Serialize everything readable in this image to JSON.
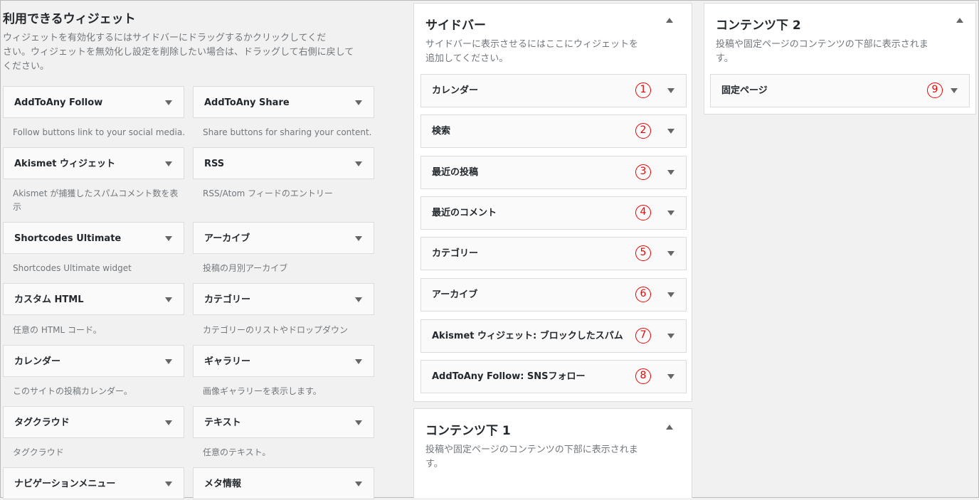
{
  "available": {
    "title": "利用できるウィジェット",
    "desc_line1": "ウィジェットを有効化するにはサイドバーにドラッグするかクリックしてくだ",
    "desc_line2": "さい。ウィジェットを無効化し設定を削除したい場合は、ドラッグして右側に戻して",
    "desc_line3": "ください。",
    "widgets": [
      {
        "name": "AddToAny Follow",
        "desc": "Follow buttons link to your social media."
      },
      {
        "name": "AddToAny Share",
        "desc": "Share buttons for sharing your content."
      },
      {
        "name": "Akismet ウィジェット",
        "desc": "Akismet が捕獲したスパムコメント数を表示"
      },
      {
        "name": "RSS",
        "desc": "RSS/Atom フィードのエントリー"
      },
      {
        "name": "Shortcodes Ultimate",
        "desc": "Shortcodes Ultimate widget"
      },
      {
        "name": "アーカイブ",
        "desc": "投稿の月別アーカイブ"
      },
      {
        "name": "カスタム HTML",
        "desc": "任意の HTML コード。"
      },
      {
        "name": "カテゴリー",
        "desc": "カテゴリーのリストやドロップダウン"
      },
      {
        "name": "カレンダー",
        "desc": "このサイトの投稿カレンダー。"
      },
      {
        "name": "ギャラリー",
        "desc": "画像ギャラリーを表示します。"
      },
      {
        "name": "タグクラウド",
        "desc": "タグクラウド"
      },
      {
        "name": "テキスト",
        "desc": "任意のテキスト。"
      },
      {
        "name": "ナビゲーションメニュー",
        "desc": ""
      },
      {
        "name": "メタ情報",
        "desc": ""
      }
    ]
  },
  "sidebar": {
    "title": "サイドバー",
    "desc_line1": "サイドバーに表示させるにはここにウィジェットを",
    "desc_line2": "追加してください。",
    "widgets": [
      {
        "name": "カレンダー",
        "marker": "1"
      },
      {
        "name": "検索",
        "marker": "2"
      },
      {
        "name": "最近の投稿",
        "marker": "3"
      },
      {
        "name": "最近のコメント",
        "marker": "4"
      },
      {
        "name": "カテゴリー",
        "marker": "5"
      },
      {
        "name": "アーカイブ",
        "marker": "6"
      },
      {
        "name": "Akismet ウィジェット: ブロックしたスパム",
        "marker": "7"
      },
      {
        "name": "AddToAny Follow: SNSフォロー",
        "marker": "8"
      }
    ]
  },
  "content_below_1": {
    "title": "コンテンツ下 1",
    "desc_line1": "投稿や固定ページのコンテンツの下部に表示されま",
    "desc_line2": "す。"
  },
  "content_below_2": {
    "title": "コンテンツ下 2",
    "desc_line1": "投稿や固定ページのコンテンツの下部に表示されま",
    "desc_line2": "す。",
    "widgets": [
      {
        "name": "固定ページ",
        "marker": "9"
      }
    ]
  },
  "colors": {
    "marker": "#e00000",
    "panel_bg": "#ffffff",
    "widget_bg": "#fafafa",
    "page_bg": "#f1f1f1"
  }
}
